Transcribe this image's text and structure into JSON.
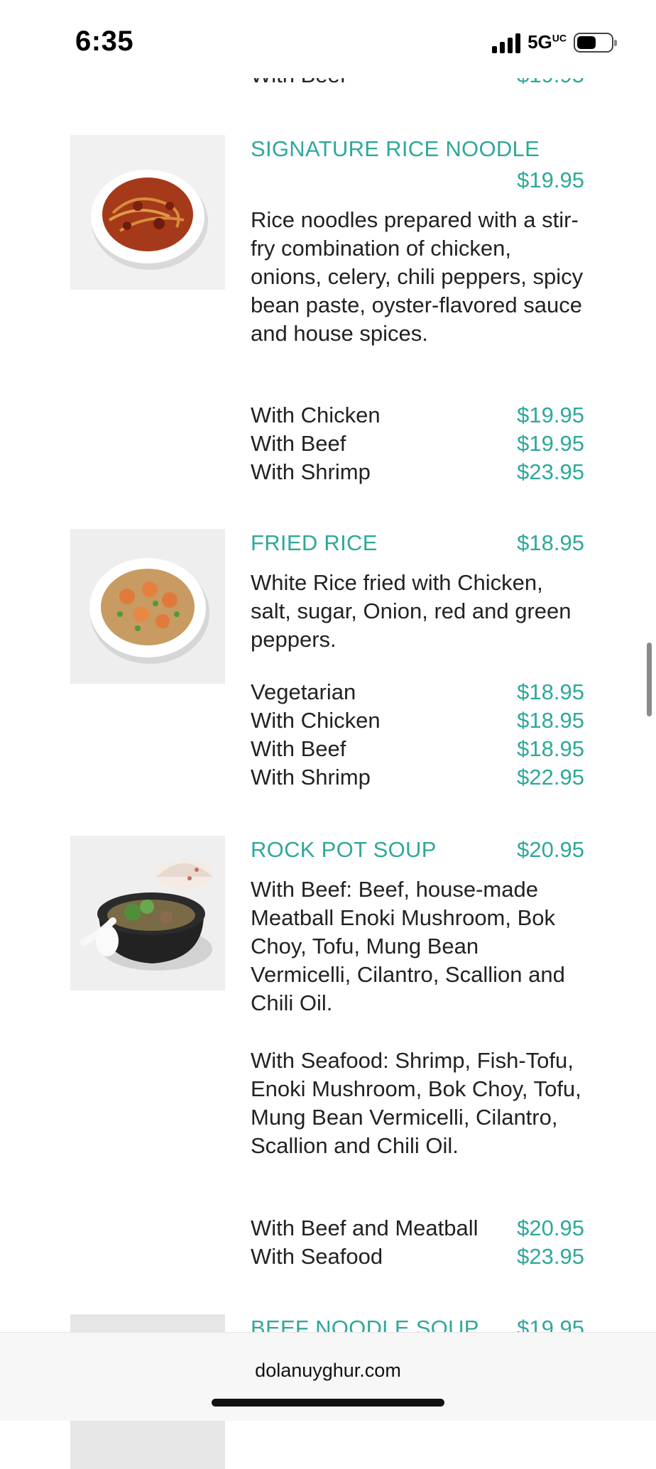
{
  "status": {
    "time": "6:35",
    "network": "5G",
    "network_sup": "UC"
  },
  "partial_top": {
    "label": "With Beef",
    "price": "$19.95"
  },
  "items": [
    {
      "name": "SIGNATURE RICE NOODLE",
      "price": "$19.95",
      "description": "Rice noodles prepared with a stir-fry combination of chicken, onions, celery, chili peppers, spicy bean paste, oyster-flavored sauce and house spices.",
      "variants": [
        {
          "label": "With Chicken",
          "price": "$19.95"
        },
        {
          "label": "With Beef",
          "price": "$19.95"
        },
        {
          "label": "With Shrimp",
          "price": "$23.95"
        }
      ]
    },
    {
      "name": "FRIED RICE",
      "price": "$18.95",
      "description": "White Rice fried with Chicken, salt, sugar, Onion, red and green peppers.",
      "variants": [
        {
          "label": "Vegetarian",
          "price": "$18.95"
        },
        {
          "label": "With Chicken",
          "price": "$18.95"
        },
        {
          "label": "With Beef",
          "price": "$18.95"
        },
        {
          "label": "With Shrimp",
          "price": "$22.95"
        }
      ]
    },
    {
      "name": "ROCK POT SOUP",
      "price": "$20.95",
      "description": "With Beef: Beef, house-made Meatball Enoki Mushroom, Bok Choy, Tofu, Mung Bean Vermicelli, Cilantro, Scallion and Chili Oil.",
      "description2": "With Seafood: Shrimp, Fish-Tofu, Enoki Mushroom, Bok Choy, Tofu, Mung Bean Vermicelli, Cilantro, Scallion and Chili Oil.",
      "variants": [
        {
          "label": "With Beef and Meatball",
          "price": "$20.95"
        },
        {
          "label": "With Seafood",
          "price": "$23.95"
        }
      ]
    },
    {
      "name": "BEEF NOODLE SOUP",
      "price": "$19.95"
    }
  ],
  "browser": {
    "domain": "dolanuyghur.com"
  }
}
